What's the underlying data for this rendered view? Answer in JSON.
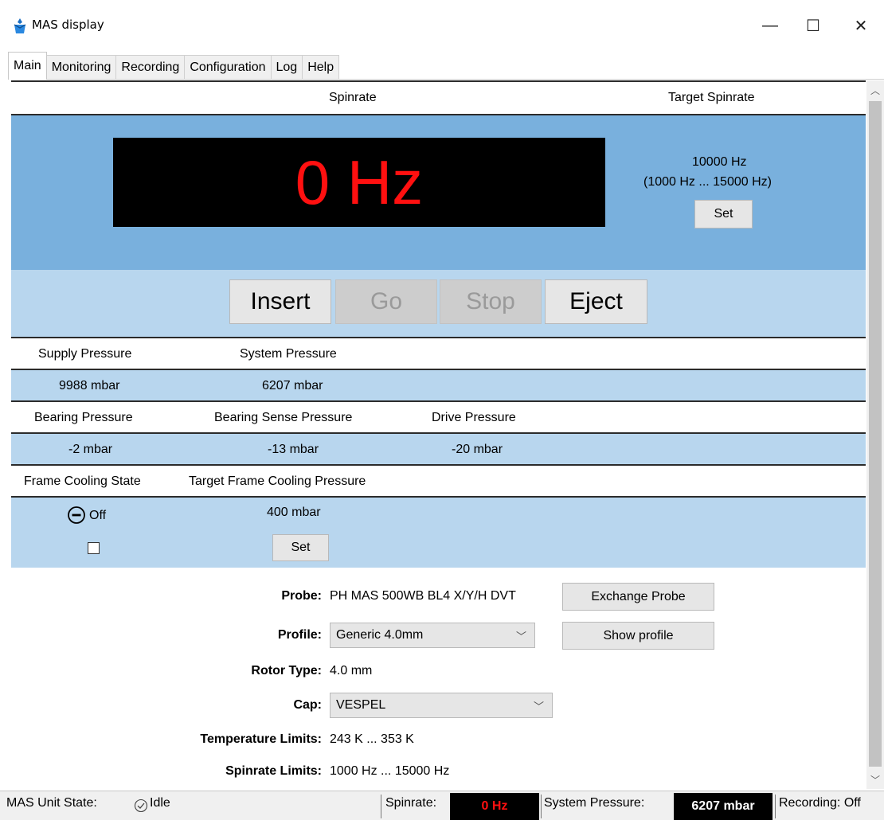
{
  "window": {
    "title": "MAS display",
    "min_glyph": "—",
    "max_glyph": "☐",
    "close_glyph": "✕"
  },
  "tabs": [
    {
      "label": "Main"
    },
    {
      "label": "Monitoring"
    },
    {
      "label": "Recording"
    },
    {
      "label": "Configuration"
    },
    {
      "label": "Log"
    },
    {
      "label": "Help"
    }
  ],
  "spin": {
    "header_label": "Spinrate",
    "target_header": "Target Spinrate",
    "value": "0 Hz",
    "target_value": "10000 Hz",
    "target_range": "(1000 Hz ... 15000 Hz)",
    "set_label": "Set"
  },
  "controls": {
    "insert": "Insert",
    "go": "Go",
    "stop": "Stop",
    "eject": "Eject"
  },
  "pressures": {
    "supply_label": "Supply Pressure",
    "system_label": "System Pressure",
    "supply_value": "9988 mbar",
    "system_value": "6207 mbar",
    "bearing_label": "Bearing Pressure",
    "bearing_sense_label": "Bearing Sense Pressure",
    "drive_label": "Drive Pressure",
    "bearing_value": "-2 mbar",
    "bearing_sense_value": "-13 mbar",
    "drive_value": "-20 mbar"
  },
  "cooling": {
    "state_label": "Frame Cooling State",
    "target_label": "Target Frame Cooling Pressure",
    "state_value": "Off",
    "target_value": "400 mbar",
    "set_label": "Set",
    "checkbox_checked": false
  },
  "probe": {
    "probe_label": "Probe:",
    "probe_value": "PH MAS 500WB BL4 X/Y/H DVT",
    "exchange_label": "Exchange Probe",
    "profile_label": "Profile:",
    "profile_value": "Generic 4.0mm",
    "show_profile_label": "Show profile",
    "rotor_label": "Rotor Type:",
    "rotor_value": "4.0 mm",
    "cap_label": "Cap:",
    "cap_value": "VESPEL",
    "temp_label": "Temperature Limits:",
    "temp_value": "243 K ... 353 K",
    "spin_limits_label": "Spinrate Limits:",
    "spin_limits_value": "1000 Hz ... 15000 Hz"
  },
  "statusbar": {
    "unit_state_label": "MAS Unit State:",
    "unit_state_value": "Idle",
    "spinrate_label": "Spinrate:",
    "spinrate_value": "0 Hz",
    "system_pressure_label": "System Pressure:",
    "system_pressure_value": "6207 mbar",
    "recording_label": "Recording:",
    "recording_value": "Off"
  },
  "colors": {
    "spin_band": "#79b0dd",
    "data_band": "#b8d6ee",
    "spin_value": "#ff1010",
    "statusbar_spin_value": "#ff1010"
  },
  "icons": {
    "app": "app-icon",
    "cooling_state": "minus-circle-icon",
    "idle": "check-circle-icon",
    "dropdown": "chevron-down-icon",
    "scroll_up": "chevron-up-icon",
    "scroll_down": "chevron-down-icon"
  }
}
